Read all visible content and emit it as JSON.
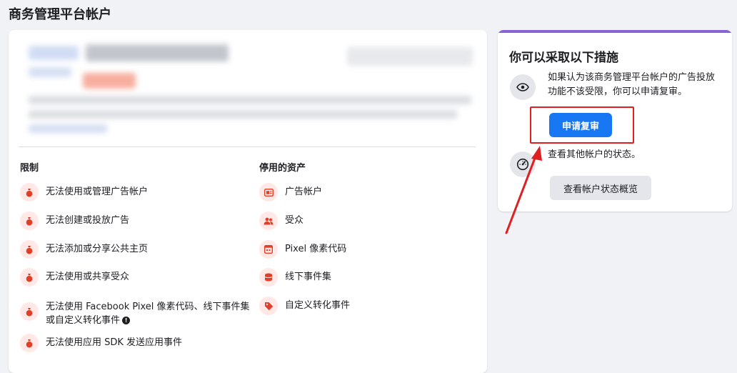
{
  "page": {
    "title": "商务管理平台帐户"
  },
  "restrictions": {
    "heading": "限制",
    "items": [
      {
        "label": "无法使用或管理广告帐户",
        "icon": "money-bag-icon"
      },
      {
        "label": "无法创建或投放广告",
        "icon": "money-bag-icon"
      },
      {
        "label": "无法添加或分享公共主页",
        "icon": "money-bag-icon"
      },
      {
        "label": "无法使用或共享受众",
        "icon": "money-bag-icon"
      },
      {
        "label": "无法使用 Facebook Pixel 像素代码、线下事件集或自定义转化事件",
        "icon": "money-bag-icon"
      },
      {
        "label": "无法使用应用 SDK 发送应用事件",
        "icon": "money-bag-icon"
      }
    ]
  },
  "disabled_assets": {
    "heading": "停用的资产",
    "items": [
      {
        "label": "广告帐户",
        "icon": "ad-account-icon"
      },
      {
        "label": "受众",
        "icon": "audience-icon"
      },
      {
        "label": "Pixel 像素代码",
        "icon": "pixel-icon"
      },
      {
        "label": "线下事件集",
        "icon": "offline-events-icon"
      },
      {
        "label": "自定义转化事件",
        "icon": "tag-icon"
      }
    ]
  },
  "actions": {
    "title": "你可以采取以下措施",
    "appeal_text": "如果认为该商务管理平台帐户的广告投放功能不该受限，你可以申请复审。",
    "appeal_button": "申请复审",
    "status_text": "查看其他帐户的状态。",
    "status_button": "查看帐户状态概览"
  },
  "colors": {
    "accent": "#1877f2",
    "alert_icon": "#e0402a",
    "card_top_bar": "#8a63d2",
    "annotation_red": "#e02020"
  }
}
